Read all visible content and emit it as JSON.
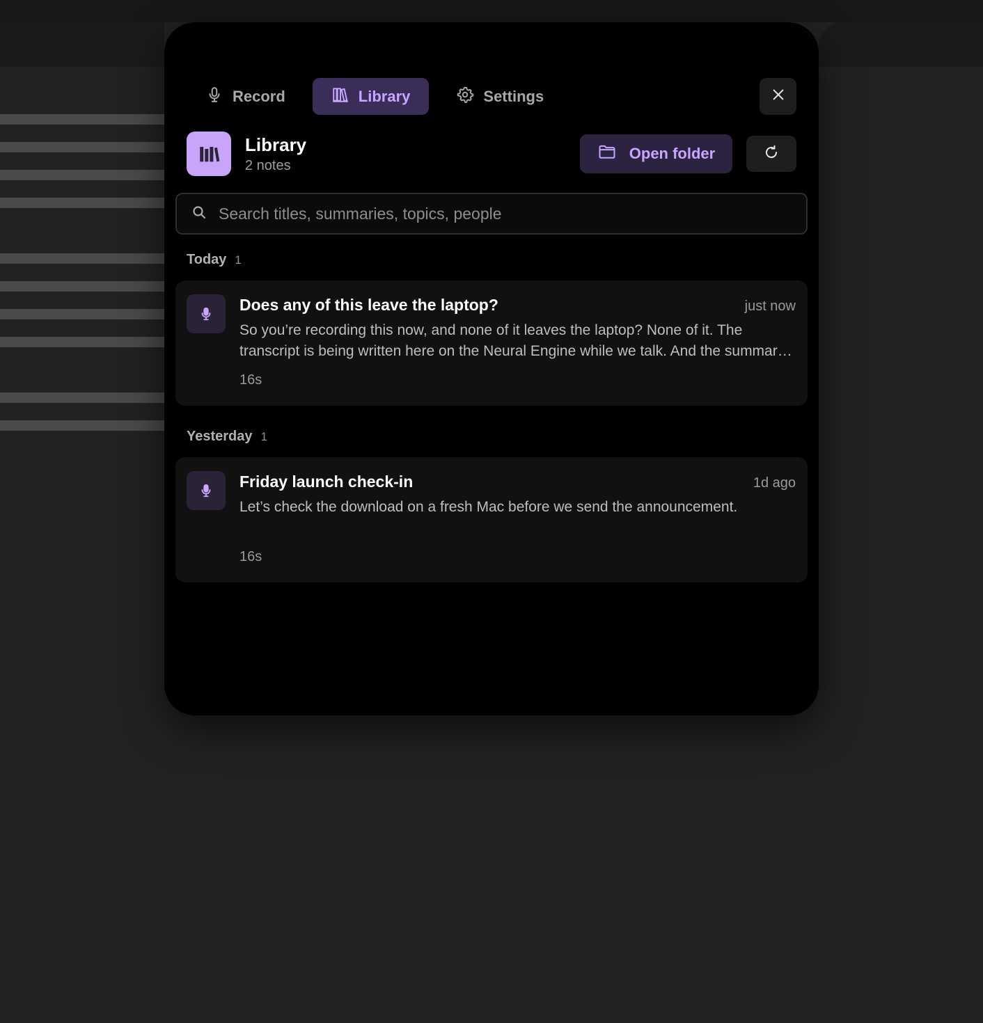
{
  "nav": {
    "tabs": [
      {
        "label": "Record",
        "icon": "microphone-icon",
        "active": false
      },
      {
        "label": "Library",
        "icon": "library-icon",
        "active": true
      },
      {
        "label": "Settings",
        "icon": "gear-icon",
        "active": false
      }
    ],
    "close_icon": "close-icon"
  },
  "library": {
    "title": "Library",
    "count": "2 notes",
    "open_folder_label": "Open folder",
    "refresh_icon": "refresh-icon"
  },
  "search": {
    "placeholder": "Search titles, summaries, topics, people",
    "value": ""
  },
  "groups": [
    {
      "label": "Today",
      "count": "1",
      "notes": [
        {
          "title": "Does any of this leave the laptop?",
          "time": "just now",
          "summary": "So you’re recording this now, and none of it leaves the laptop? None of it. The transcript is being written here on the Neural Engine while we talk. And the summary and topics are generated on the same machine too.",
          "duration": "16s"
        }
      ]
    },
    {
      "label": "Yesterday",
      "count": "1",
      "notes": [
        {
          "title": "Friday launch check-in",
          "time": "1d ago",
          "summary": "Let’s check the download on a fresh Mac before we send the announcement.",
          "duration": "16s"
        }
      ]
    }
  ],
  "colors": {
    "accent": "#c9a6ff",
    "accent_bg": "#3a2d57",
    "panel_bg": "#000000",
    "card_bg": "#111112",
    "page_bg": "#222222"
  }
}
